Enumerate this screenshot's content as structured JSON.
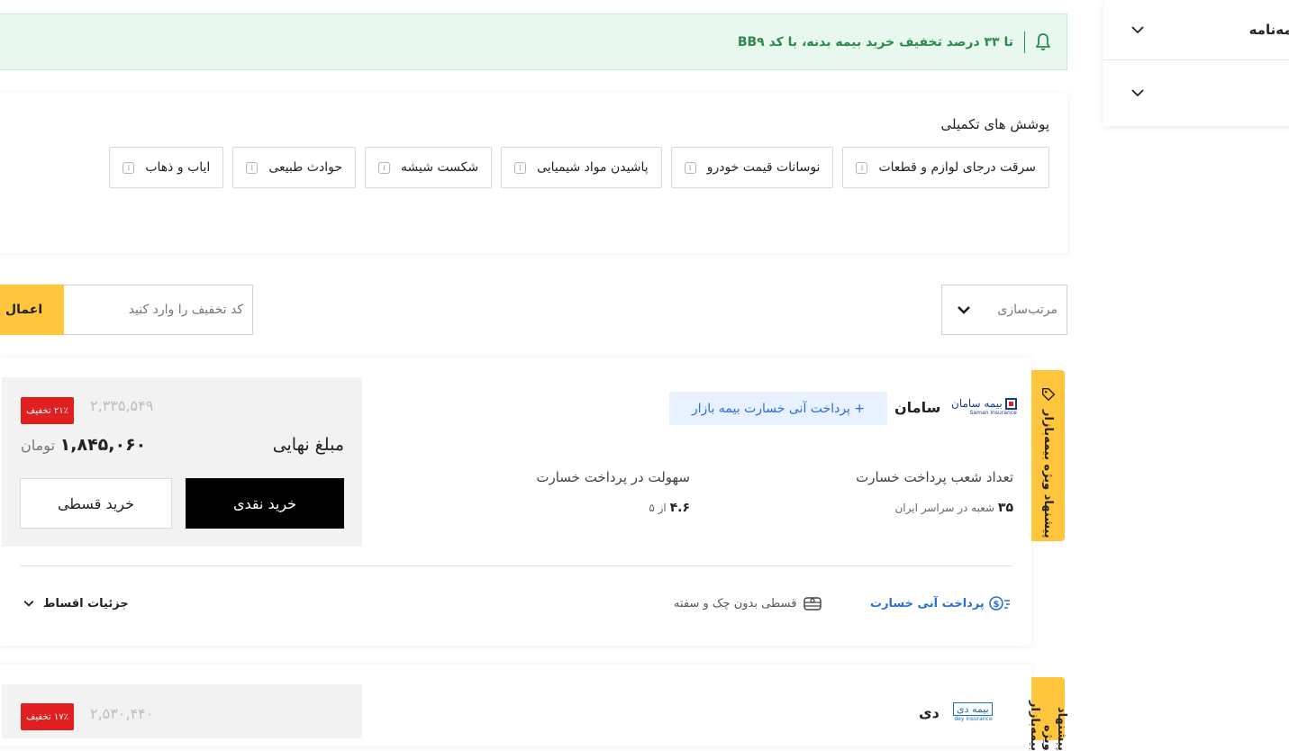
{
  "filters": [
    {
      "label": "یمه‌نامه"
    },
    {
      "label": ""
    }
  ],
  "promo": {
    "text": "تا ۳۳ درصد تخفیف خرید بیمه بدنه، با کد BB۹"
  },
  "coverages": {
    "title": "پوشش های تکمیلی",
    "items": [
      {
        "label": "سرقت درجای لوازم و قطعات"
      },
      {
        "label": "نوسانات قیمت خودرو"
      },
      {
        "label": "پاشیدن مواد شیمیایی"
      },
      {
        "label": "شکست شیشه"
      },
      {
        "label": "حوادث طبیعی"
      },
      {
        "label": "ایاب و ذهاب"
      }
    ]
  },
  "sort": {
    "label": "مرتب‌سازی"
  },
  "discount": {
    "placeholder": "کد تخفیف را وارد کنید",
    "apply_label": "اعمال"
  },
  "offers": [
    {
      "tab_label": "پیشنهاد ویژه بیمه‌بازار",
      "insurer_name": "سامان",
      "logo_text": "بیمه سامان",
      "logo_sub": "Saman Insurance",
      "badge": "+ پرداخت آنی خسارت بیمه بازار",
      "stats": [
        {
          "label": "تعداد شعب پرداخت خسارت",
          "value": "۳۵",
          "unit": "شعبه در سراسر ایران"
        },
        {
          "label": "سهولت در پرداخت خسارت",
          "value": "۴.۶",
          "unit": "از ۵"
        }
      ],
      "old_price": "۲,۳۳۵,۵۴۹",
      "discount_badge": "۲۱٪ تخفیف",
      "final_label": "مبلغ نهایی",
      "final_price": "۱,۸۴۵,۰۶۰",
      "currency": "تومان",
      "cash_button": "خرید نقدی",
      "installment_button": "خرید قسطی",
      "footer": {
        "instant_claim": "پرداخت آنی خسارت",
        "installment_note": "قسطی بدون چک و سفته",
        "details": "جزئیات اقساط"
      }
    },
    {
      "tab_label": "پیشنهاد ویژه بیمه‌بازار",
      "insurer_name": "دی",
      "logo_text": "بیمه دی",
      "logo_sub": "dey insurance",
      "old_price": "۲,۵۳۰,۴۴۰",
      "discount_badge": "۱۷٪ تخفیف"
    }
  ],
  "colors": {
    "accent_yellow": "#ffc53d",
    "promo_green": "#2c8a4e",
    "promo_bg": "#e8f8ee",
    "link_blue": "#2a6fd6",
    "discount_red": "#e02020",
    "button_black": "#000000"
  }
}
